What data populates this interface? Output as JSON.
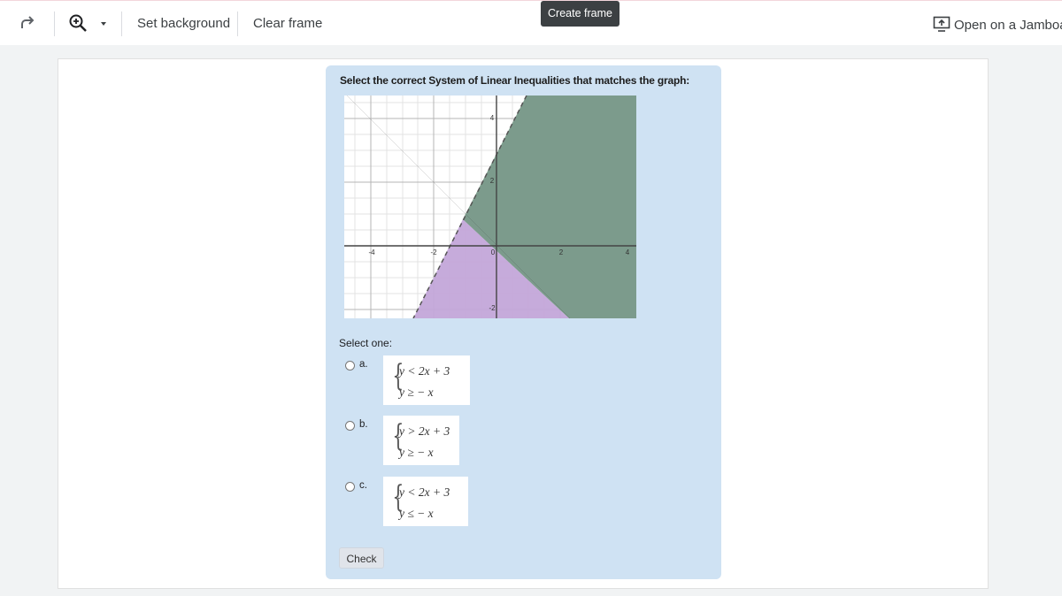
{
  "toolbar": {
    "set_background": "Set background",
    "clear_frame": "Clear frame",
    "tooltip": "Create frame",
    "open_jamboard": "Open on a Jamboard"
  },
  "quiz": {
    "question": "Select the correct System of Linear Inequalities that matches the graph:",
    "select_one": "Select one:",
    "options": [
      {
        "letter": "a.",
        "line1": "y < 2x + 3",
        "line2": "y ≥ − x"
      },
      {
        "letter": "b.",
        "line1": "y > 2x + 3",
        "line2": "y ≥ − x"
      },
      {
        "letter": "c.",
        "line1": "y < 2x + 3",
        "line2": "y ≤ − x"
      }
    ],
    "check_label": "Check"
  },
  "graph": {
    "x_ticks": [
      "-4",
      "-2",
      "0",
      "2",
      "4"
    ],
    "y_ticks": [
      "4",
      "2",
      "-2"
    ],
    "colors": {
      "green": "#a8d5a2",
      "purple": "#c3a6d9",
      "overlap": "#7c9b8c",
      "dashed": "#555555"
    }
  }
}
